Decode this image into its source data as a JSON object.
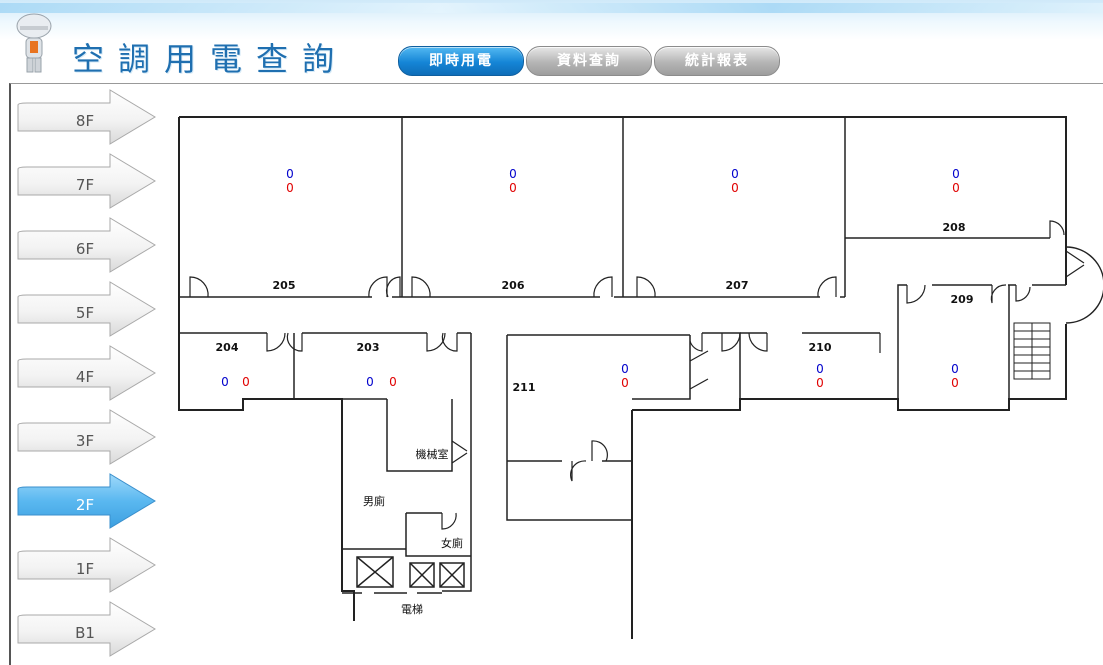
{
  "header": {
    "title": "空調用電查詢",
    "tabs": [
      {
        "label": "即時用電",
        "active": true
      },
      {
        "label": "資料查詢",
        "active": false
      },
      {
        "label": "統計報表",
        "active": false
      }
    ]
  },
  "floors": [
    {
      "label": "8F",
      "active": false
    },
    {
      "label": "7F",
      "active": false
    },
    {
      "label": "6F",
      "active": false
    },
    {
      "label": "5F",
      "active": false
    },
    {
      "label": "4F",
      "active": false
    },
    {
      "label": "3F",
      "active": false
    },
    {
      "label": "2F",
      "active": true
    },
    {
      "label": "1F",
      "active": false
    },
    {
      "label": "B1",
      "active": false
    }
  ],
  "rooms": {
    "r205": {
      "name": "205",
      "blue": "0",
      "red": "0"
    },
    "r206": {
      "name": "206",
      "blue": "0",
      "red": "0"
    },
    "r207": {
      "name": "207",
      "blue": "0",
      "red": "0"
    },
    "r208": {
      "name": "208",
      "blue": "0",
      "red": "0"
    },
    "r204": {
      "name": "204",
      "blue": "0",
      "red": "0"
    },
    "r203": {
      "name": "203",
      "blue": "0",
      "red": "0"
    },
    "r211": {
      "name": "211",
      "blue": "0",
      "red": "0"
    },
    "r210": {
      "name": "210",
      "blue": "0",
      "red": "0"
    },
    "r209": {
      "name": "209",
      "blue": "0",
      "red": "0"
    }
  },
  "facilities": {
    "machine_room": "機械室",
    "mens_restroom": "男廁",
    "womens_restroom": "女廁",
    "elevator": "電梯"
  },
  "colors": {
    "value_blue": "#0000cc",
    "value_red": "#e00000",
    "accent": "#1585d6",
    "floor_active": "#5ab8f0"
  }
}
